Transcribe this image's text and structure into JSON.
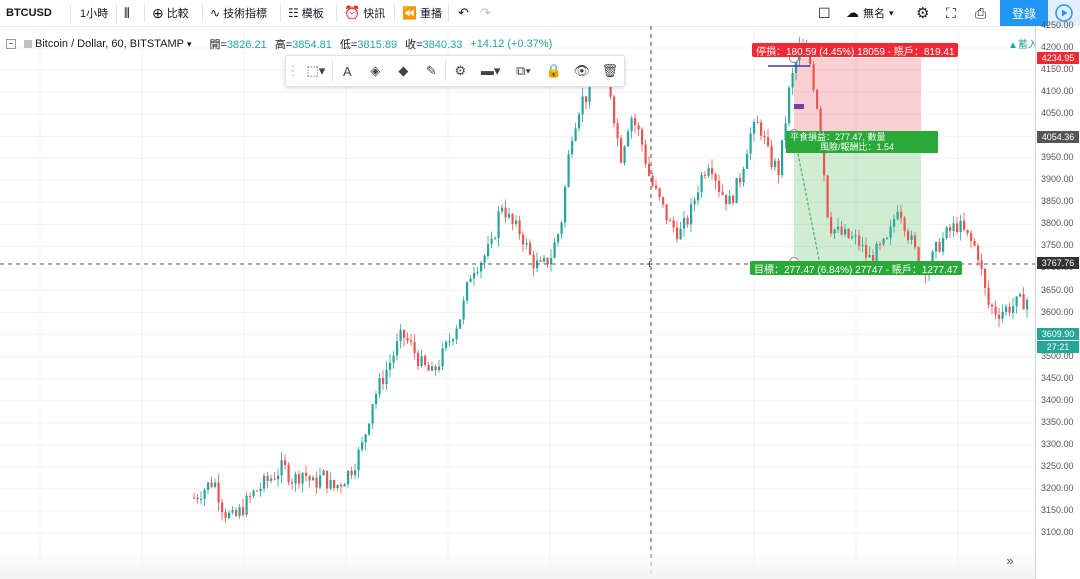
{
  "toolbar": {
    "symbol": "BTCUSD",
    "interval": "1小時",
    "compare": "比較",
    "indicators": "技術指標",
    "templates": "模板",
    "alert": "快訊",
    "replay": "重播",
    "layout_name": "無名",
    "sign_in": "登錄"
  },
  "legend": {
    "name": "Bitcoin / Dollar, 60, BITSTAMP",
    "open_label": "開=",
    "open": "3826.21",
    "high_label": "高=",
    "high": "3854.81",
    "low_label": "低=",
    "low": "3815.89",
    "close_label": "收=",
    "close": "3840.33",
    "change": "+14.12 (+0.37%)",
    "hint": "▲蓄入"
  },
  "position": {
    "stop_label": "停損：180.59 (4.45%) 18059 - 賬戶：819.41",
    "target_label": "目標：277.47 (6.84%) 27747 - 賬戶：1277.47",
    "pnl_line1": "平食損益：277.47, 數量",
    "pnl_line2": "風險/報酬比：1.54"
  },
  "price_axis": {
    "ticks": [
      "4250.00",
      "4200.00",
      "4150.00",
      "4100.00",
      "4050.00",
      "4000.00",
      "3950.00",
      "3900.00",
      "3850.00",
      "3800.00",
      "3750.00",
      "3700.00",
      "3650.00",
      "3600.00",
      "3550.00",
      "3500.00",
      "3450.00",
      "3400.00",
      "3350.00",
      "3300.00",
      "3250.00",
      "3200.00",
      "3150.00",
      "3100.00"
    ],
    "stop_price": "4234.95",
    "entry_price": "4054.36",
    "crosshair_price": "3767.76",
    "last_price": "3609.90",
    "countdown": "27:21"
  },
  "colors": {
    "up": "#26a69a",
    "down": "#ef5350",
    "accent": "#2196f3",
    "stop_zone": "#ef2a34",
    "target_zone": "#2aa838"
  },
  "chart_data": {
    "type": "candlestick",
    "price_range": [
      3100,
      4250
    ],
    "close_path": [
      3180,
      3200,
      3220,
      3150,
      3130,
      3160,
      3190,
      3210,
      3230,
      3250,
      3220,
      3240,
      3210,
      3230,
      3200,
      3220,
      3250,
      3300,
      3400,
      3450,
      3500,
      3550,
      3520,
      3480,
      3460,
      3500,
      3550,
      3600,
      3700,
      3720,
      3750,
      3850,
      3800,
      3780,
      3720,
      3700,
      3730,
      3800,
      4000,
      4080,
      4100,
      4150,
      4100,
      3950,
      4050,
      4000,
      3900,
      3850,
      3800,
      3780,
      3820,
      3900,
      3950,
      3880,
      3850,
      3900,
      4000,
      4030,
      3950,
      3920,
      4100,
      4200,
      4180,
      4050,
      3800,
      3780,
      3770,
      3760,
      3720,
      3740,
      3760,
      3850,
      3780,
      3720,
      3700,
      3750,
      3780,
      3800,
      3770,
      3740,
      3620,
      3600,
      3610,
      3620,
      3630
    ]
  }
}
